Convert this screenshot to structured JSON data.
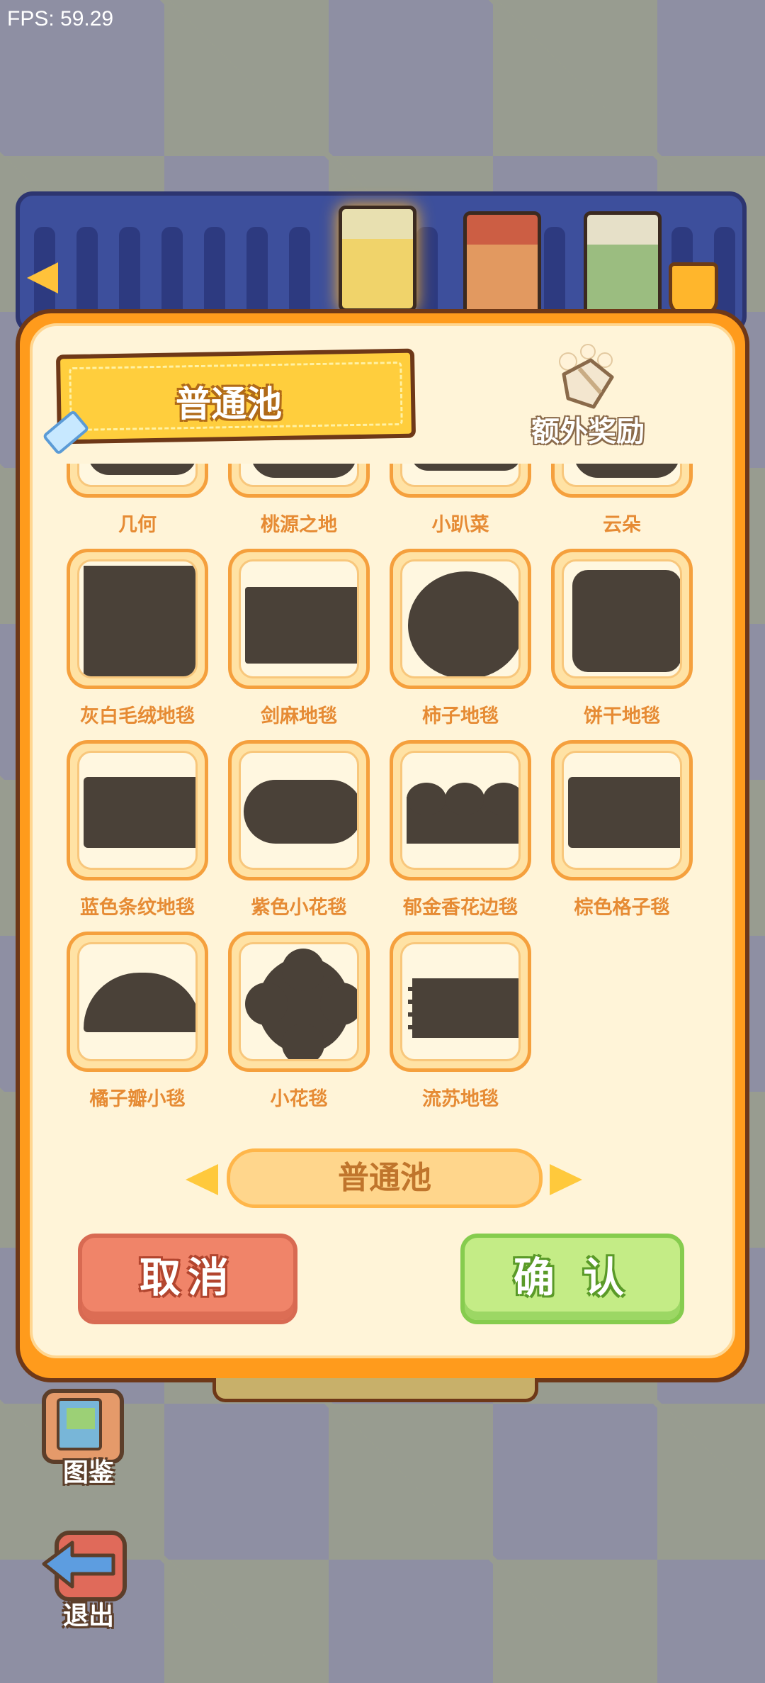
{
  "hud": {
    "fps": "FPS: 59.29"
  },
  "panel": {
    "title": "普通池",
    "bonus_label": "额外奖励"
  },
  "items": [
    {
      "name": "几何",
      "shape": "cut"
    },
    {
      "name": "桃源之地",
      "shape": "cut"
    },
    {
      "name": "小趴菜",
      "shape": "cut"
    },
    {
      "name": "云朵",
      "shape": "cut"
    },
    {
      "name": "灰白毛绒地毯",
      "shape": "square"
    },
    {
      "name": "剑麻地毯",
      "shape": "wide"
    },
    {
      "name": "柿子地毯",
      "shape": "circle"
    },
    {
      "name": "饼干地毯",
      "shape": "cookie"
    },
    {
      "name": "蓝色条纹地毯",
      "shape": "wide"
    },
    {
      "name": "紫色小花毯",
      "shape": "pill"
    },
    {
      "name": "郁金香花边毯",
      "shape": "scallop"
    },
    {
      "name": "棕色格子毯",
      "shape": "wide"
    },
    {
      "name": "橘子瓣小毯",
      "shape": "half"
    },
    {
      "name": "小花毯",
      "shape": "flower"
    },
    {
      "name": "流苏地毯",
      "shape": "fringe"
    }
  ],
  "pool_selector": {
    "label": "普通池"
  },
  "buttons": {
    "cancel": "取消",
    "confirm": "确 认"
  },
  "side": {
    "catalog": "图鉴",
    "exit": "退出"
  }
}
